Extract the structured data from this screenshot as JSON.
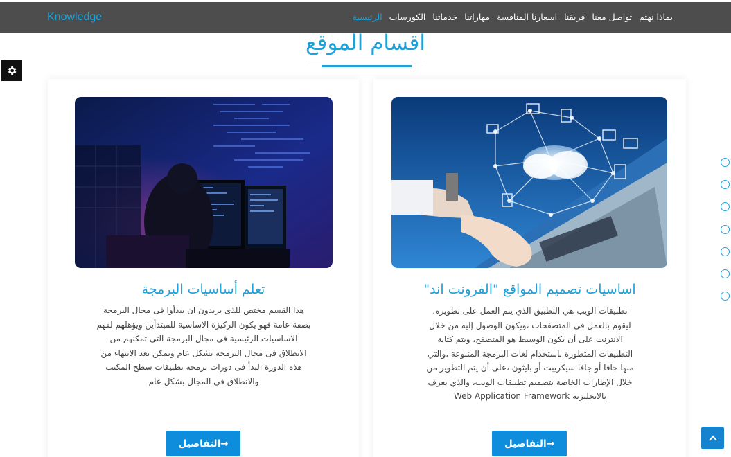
{
  "brand": "Knowledge",
  "nav": [
    {
      "label": "الرئيسية",
      "active": true
    },
    {
      "label": "الكورسات",
      "active": false
    },
    {
      "label": "خدماتنا",
      "active": false
    },
    {
      "label": "مهاراتنا",
      "active": false
    },
    {
      "label": "اسعارنا المنافسة",
      "active": false
    },
    {
      "label": "فريقنا",
      "active": false
    },
    {
      "label": "تواصل معنا",
      "active": false
    },
    {
      "label": "بماذا نهتم",
      "active": false
    }
  ],
  "section": {
    "title": "اقسام الموقع"
  },
  "cards": [
    {
      "title": "تعلم أساسيات البرمجة",
      "text": "هذا القسم مختص للذى يريدون ان يبدأوا فى مجال البرمجة بصفة عامة فهو يكون الركيزة الاساسية للمبتدأين ويؤهلهم لفهم الاساسيات الرئيسية فى مجال البرمجة التى تمكنهم من الانطلاق فى مجال البرمجة بشكل عام ويمكن بعد الانتهاء من هذه الدورة البدأ فى دورات برمجة تطبيقات سطح المكتب والانطلاق فى المجال بشكل عام",
      "button": "التفاصيل→"
    },
    {
      "title": "اساسيات تصميم المواقع \"الفرونت اند\"",
      "text": "تطبيقات الويب هي التطبيق الذي يتم العمل على تطويره، ليقوم بالعمل في المتصفحات ،ويكون الوصول إليه من خلال الانترنت على أن يكون الوسيط هو المتصفح، ويتم كتابة التطبيقات المتطورة باستخدام لغات البرمجة المتنوعة ،والتي منها جافا أو جافا سيكريبت أو بايثون ،على أن يتم التطوير من خلال الإطارات الخاصة بتصميم تطبيقات الويب، والذي يعرف بالانجليزية Web Application Framework",
      "button": "التفاصيل→"
    }
  ],
  "icons": {
    "settings": "gear-icon",
    "scroll_top": "chevron-up-icon",
    "dots": "nav-dot-icon"
  },
  "colors": {
    "accent": "#1ea1d9",
    "navbar": "#4d4d4d",
    "button": "#0d8ddc"
  }
}
